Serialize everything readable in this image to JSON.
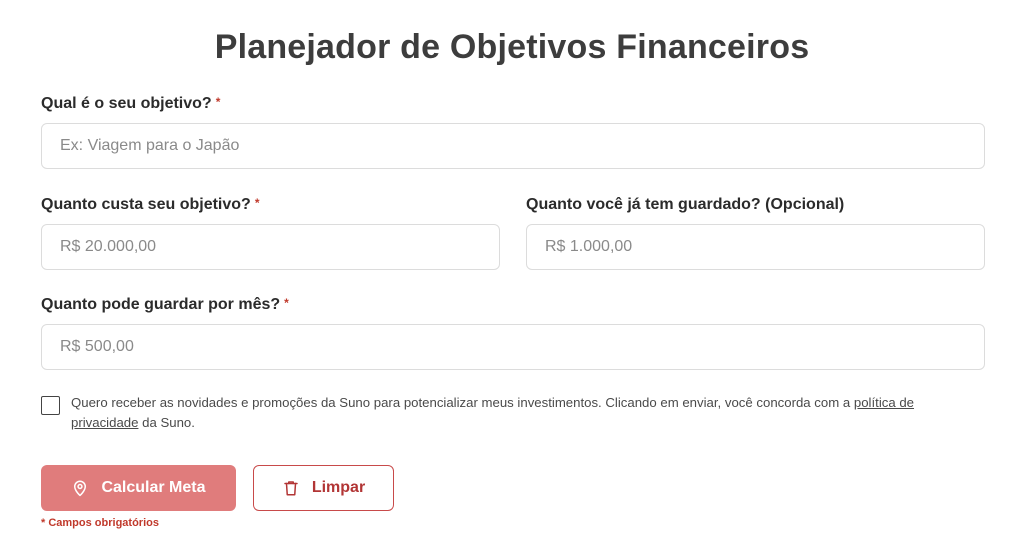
{
  "title": "Planejador de Objetivos Financeiros",
  "fields": {
    "goal": {
      "label": "Qual é o seu objetivo?",
      "required_mark": "*",
      "placeholder": "Ex: Viagem para o Japão",
      "value": ""
    },
    "cost": {
      "label": "Quanto custa seu objetivo?",
      "required_mark": "*",
      "placeholder": "R$ 20.000,00",
      "value": ""
    },
    "saved": {
      "label": "Quanto você já tem guardado? (Opcional)",
      "placeholder": "R$ 1.000,00",
      "value": ""
    },
    "monthly": {
      "label": "Quanto pode guardar por mês?",
      "required_mark": "*",
      "placeholder": "R$ 500,00",
      "value": ""
    }
  },
  "consent": {
    "text_before": "Quero receber as novidades e promoções da Suno para potencializar meus investimentos. Clicando em enviar, você concorda com a ",
    "link_text": "política de privacidade",
    "text_after": " da Suno.",
    "checked": false
  },
  "buttons": {
    "calculate": {
      "label": "Calcular Meta",
      "icon": "map-pin-icon"
    },
    "clear": {
      "label": "Limpar",
      "icon": "trash-icon"
    }
  },
  "required_note": "* Campos obrigatórios",
  "colors": {
    "primary_button": "#e07c7c",
    "accent_red": "#c0392b",
    "title": "#3d3d3d"
  }
}
